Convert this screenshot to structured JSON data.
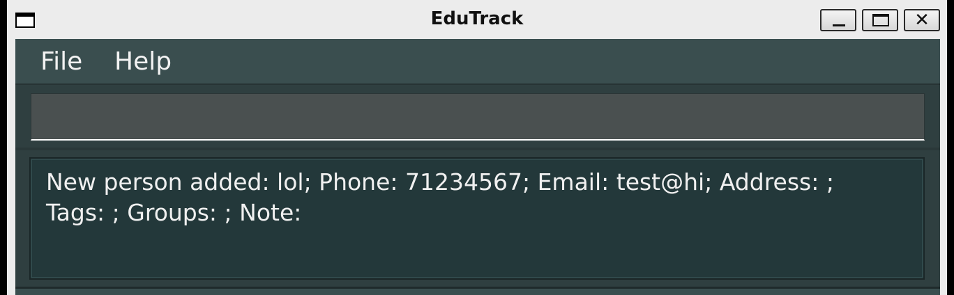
{
  "window": {
    "title": "EduTrack",
    "controls": {
      "minimize_icon": "minimize-icon",
      "maximize_icon": "maximize-icon",
      "close_icon": "close-icon",
      "close_glyph": "✕"
    }
  },
  "menu": {
    "items": [
      {
        "label": "File"
      },
      {
        "label": "Help"
      }
    ]
  },
  "command_box": {
    "value": "",
    "placeholder": ""
  },
  "result_display": {
    "text": "New person added: lol; Phone: 71234567; Email: test@hi; Address: ;\nTags: ; Groups: ; Note:"
  },
  "colors": {
    "app_background": "#3a4e4f",
    "panel_background": "#2f3f40",
    "input_background": "#4a5050",
    "result_background": "#23383a",
    "text": "#f0f0f0"
  }
}
